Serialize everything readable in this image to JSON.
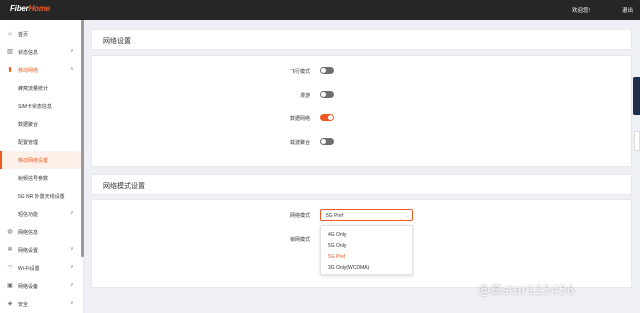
{
  "header": {
    "logo_prefix": "Fiber",
    "logo_suffix": "Home",
    "welcome": "欢迎您!",
    "logout": "退出"
  },
  "sidebar": {
    "items": [
      {
        "label": "首页",
        "icon": "home-icon",
        "chevron": ""
      },
      {
        "label": "状态信息",
        "icon": "chart-icon",
        "chevron": "∨"
      },
      {
        "label": "移动网络",
        "icon": "signal-icon",
        "chevron": "∧"
      },
      {
        "label": "蜂窝流量统计",
        "sub": true
      },
      {
        "label": "SIM卡状态信息",
        "sub": true
      },
      {
        "label": "数据聚合",
        "sub": true
      },
      {
        "label": "配置管理",
        "sub": true
      },
      {
        "label": "移动网络设置",
        "sub": true,
        "active": true
      },
      {
        "label": "射频信号参数",
        "sub": true
      },
      {
        "label": "5G NR 外置天线设置",
        "sub": true
      },
      {
        "label": "短信功能",
        "chevron": "∨"
      },
      {
        "label": "网络信息",
        "icon": "globe-icon",
        "chevron": ""
      },
      {
        "label": "网络设置",
        "icon": "settings-icon",
        "chevron": "∨"
      },
      {
        "label": "Wi-Fi设置",
        "icon": "wifi-icon",
        "chevron": "∨"
      },
      {
        "label": "网络设备",
        "icon": "device-icon",
        "chevron": "∨"
      },
      {
        "label": "安全",
        "icon": "shield-icon",
        "chevron": "∨"
      }
    ]
  },
  "network_settings": {
    "title": "网络设置",
    "rows": [
      {
        "label": "飞行模式",
        "on": false
      },
      {
        "label": "漫游",
        "on": false
      },
      {
        "label": "数据网络",
        "on": true
      },
      {
        "label": "载波聚合",
        "on": false
      }
    ]
  },
  "network_mode": {
    "title": "网络模式设置",
    "mode_label": "网络模式",
    "lock_label": "锁网模式",
    "selected": "5G Pref",
    "options": [
      "4G Only",
      "5G Only",
      "5G Pref",
      "3G Only(WCDMA)"
    ],
    "selected_option_index": 2
  },
  "watermark": "@真star123456",
  "colors": {
    "accent": "#ee5b22",
    "topbar": "#262626",
    "toggle_off": "#6f6f6f"
  }
}
